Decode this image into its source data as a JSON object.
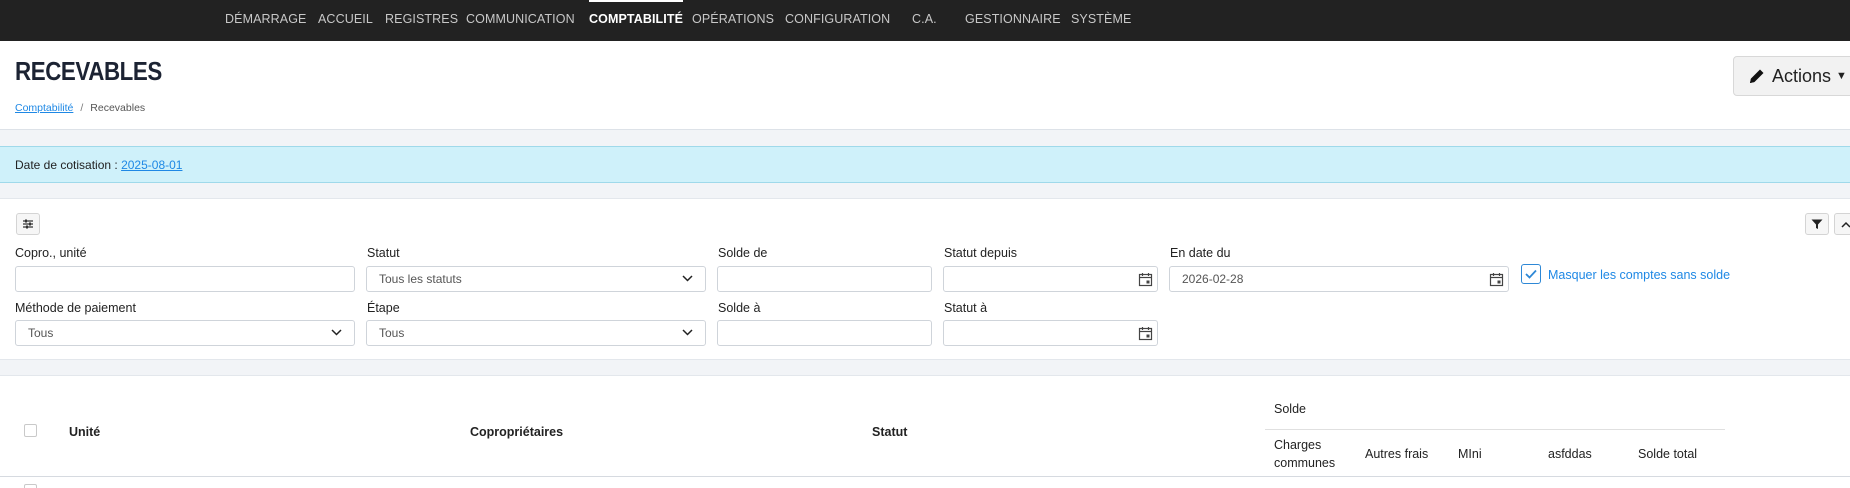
{
  "nav": {
    "items": [
      {
        "label": "DÉMARRAGE",
        "active": false
      },
      {
        "label": "ACCUEIL",
        "active": false
      },
      {
        "label": "REGISTRES",
        "active": false
      },
      {
        "label": "COMMUNICATION",
        "active": false
      },
      {
        "label": "COMPTABILITÉ",
        "active": true
      },
      {
        "label": "OPÉRATIONS",
        "active": false
      },
      {
        "label": "CONFIGURATION",
        "active": false
      },
      {
        "label": "C.A.",
        "active": false
      },
      {
        "label": "GESTIONNAIRE",
        "active": false
      },
      {
        "label": "SYSTÈME",
        "active": false
      }
    ]
  },
  "header": {
    "title": "RECEVABLES",
    "breadcrumb": {
      "parent": "Comptabilité",
      "separator": "/",
      "current": "Recevables"
    },
    "actions_label": "Actions"
  },
  "info": {
    "label": "Date de cotisation :",
    "date": "2025-08-01"
  },
  "filters": {
    "copro_unite": {
      "label": "Copro., unité",
      "value": ""
    },
    "statut": {
      "label": "Statut",
      "value": "Tous les statuts"
    },
    "solde_de": {
      "label": "Solde de",
      "value": ""
    },
    "statut_depuis": {
      "label": "Statut depuis",
      "value": ""
    },
    "en_date_du": {
      "label": "En date du",
      "value": "2026-02-28"
    },
    "masquer": {
      "label": "Masquer les comptes sans solde",
      "checked": true
    },
    "methode_paiement": {
      "label": "Méthode de paiement",
      "value": "Tous"
    },
    "etape": {
      "label": "Étape",
      "value": "Tous"
    },
    "solde_a": {
      "label": "Solde à",
      "value": ""
    },
    "statut_a": {
      "label": "Statut à",
      "value": ""
    }
  },
  "table": {
    "columns": {
      "unite": "Unité",
      "coproprietaires": "Copropriétaires",
      "statut": "Statut",
      "solde_group": "Solde",
      "charges_communes_1": "Charges",
      "charges_communes_2": "communes",
      "autres_frais": "Autres frais",
      "mini": "MIni",
      "asfddas": "asfddas",
      "solde_total": "Solde total"
    }
  },
  "colors": {
    "nav_bg": "#222222",
    "accent_link": "#1e88e5",
    "info_bg": "#cff1fa"
  }
}
